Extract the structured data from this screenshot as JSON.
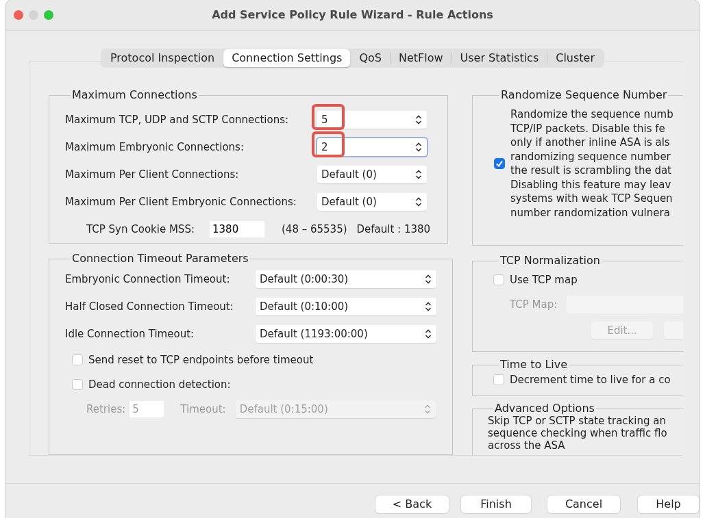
{
  "window": {
    "title": "Add Service Policy Rule Wizard - Rule Actions"
  },
  "tabs": [
    {
      "label": "Protocol Inspection",
      "selected": false
    },
    {
      "label": "Connection Settings",
      "selected": true
    },
    {
      "label": "QoS",
      "selected": false
    },
    {
      "label": "NetFlow",
      "selected": false
    },
    {
      "label": "User Statistics",
      "selected": false
    },
    {
      "label": "Cluster",
      "selected": false
    }
  ],
  "maximum_connections": {
    "title": "Maximum Connections",
    "fields": [
      {
        "label": "Maximum TCP, UDP and SCTP Connections:",
        "value": "5",
        "highlighted": true,
        "focused": false
      },
      {
        "label": "Maximum Embryonic Connections:",
        "value": "2",
        "highlighted": true,
        "focused": true
      },
      {
        "label": "Maximum Per Client Connections:",
        "value": "Default (0)",
        "highlighted": false,
        "focused": false
      },
      {
        "label": "Maximum Per Client Embryonic Connections:",
        "value": "Default (0)",
        "highlighted": false,
        "focused": false
      }
    ],
    "syn_cookie": {
      "label": "TCP Syn Cookie MSS:",
      "value": "1380",
      "range": "(48 – 65535)",
      "default": "Default : 1380"
    }
  },
  "connection_timeouts": {
    "title": "Connection Timeout Parameters",
    "fields": [
      {
        "label": "Embryonic Connection Timeout:",
        "value": "Default (0:00:30)"
      },
      {
        "label": "Half Closed Connection Timeout:",
        "value": "Default (0:10:00)"
      },
      {
        "label": "Idle Connection Timeout:",
        "value": "Default (1193:00:00)"
      }
    ],
    "options": [
      {
        "label": "Send reset to TCP endpoints before timeout",
        "checked": false
      },
      {
        "label": "Dead connection detection:",
        "checked": false
      }
    ],
    "dead_connection": {
      "disabled": true,
      "retries_label": "Retries:",
      "retries": "5",
      "timeout_label": "Timeout:",
      "timeout": "Default (0:15:00)"
    }
  },
  "randomize": {
    "title": "Randomize Sequence Number",
    "checked": true,
    "lines": [
      "Randomize the sequence numb",
      "TCP/IP packets. Disable this fe",
      "only if another inline ASA is als",
      "randomizing sequence number",
      "the result is scrambling the dat",
      "Disabling this feature may leav",
      "systems with weak TCP Sequen",
      "number randomization vulnera"
    ]
  },
  "tcp_normalization": {
    "title": "TCP Normalization",
    "use_map": {
      "label": "Use TCP map",
      "checked": false
    },
    "map_label": "TCP Map:",
    "disabled": true,
    "edit_button": "Edit..."
  },
  "time_to_live": {
    "title": "Time to Live",
    "label": "Decrement time to live for a co",
    "checked": false
  },
  "advanced": {
    "title": "Advanced Options",
    "lines": [
      "Skip TCP or SCTP state tracking an",
      "sequence checking when traffic flo",
      "across the ASA"
    ]
  },
  "buttons": [
    "< Back",
    "Finish",
    "Cancel",
    "Help"
  ]
}
